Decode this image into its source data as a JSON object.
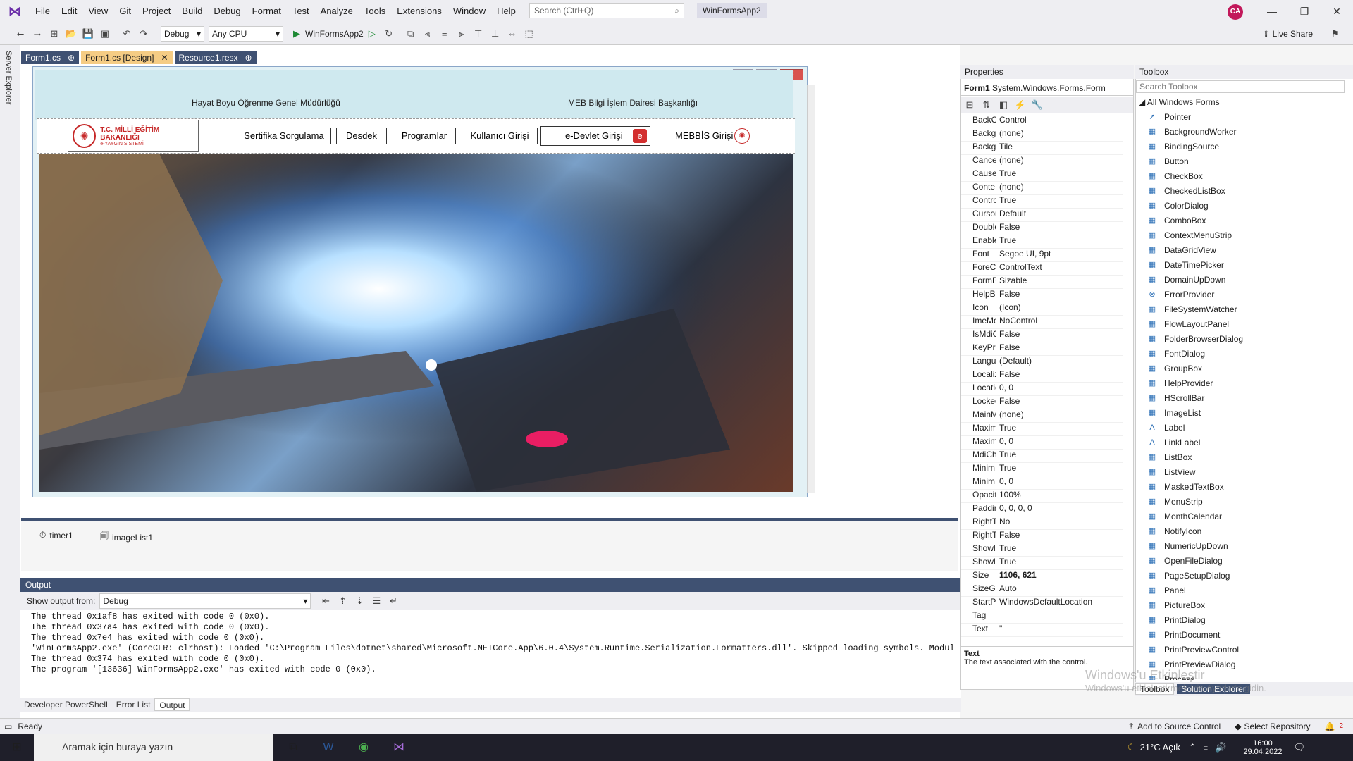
{
  "menubar": {
    "items": [
      "File",
      "Edit",
      "View",
      "Git",
      "Project",
      "Build",
      "Debug",
      "Format",
      "Test",
      "Analyze",
      "Tools",
      "Extensions",
      "Window",
      "Help"
    ],
    "search_placeholder": "Search (Ctrl+Q)",
    "app_name": "WinFormsApp2",
    "avatar": "CA"
  },
  "toolbar": {
    "config": "Debug",
    "platform": "Any CPU",
    "start": "WinFormsApp2",
    "live_share": "Live Share"
  },
  "sidebar": {
    "label": "Server Explorer"
  },
  "tabs": [
    {
      "label": "Form1.cs",
      "active": false
    },
    {
      "label": "Form1.cs [Design]",
      "active": true
    },
    {
      "label": "Resource1.resx",
      "active": false
    }
  ],
  "form": {
    "header_left": "Hayat Boyu Öğrenme Genel Müdürlüğü",
    "header_right": "MEB Bilgi İşlem Dairesi Başkanlığı",
    "logo_title": "T.C. MİLLİ EĞİTİM BAKANLIĞI",
    "logo_sub": "e-YAYGIN SİSTEMİ",
    "buttons": [
      "Sertifika Sorgulama",
      "Desdek",
      "Programlar",
      "Kullanıcı Girişi",
      "e-Devlet Girişi",
      "MEBBİS Girişi"
    ]
  },
  "tray": {
    "items": [
      "timer1",
      "imageList1"
    ]
  },
  "output": {
    "title": "Output",
    "show_from_label": "Show output from:",
    "show_from_value": "Debug",
    "lines": [
      "The thread 0x1af8 has exited with code 0 (0x0).",
      "The thread 0x37a4 has exited with code 0 (0x0).",
      "The thread 0x7e4 has exited with code 0 (0x0).",
      "'WinFormsApp2.exe' (CoreCLR: clrhost): Loaded 'C:\\Program Files\\dotnet\\shared\\Microsoft.NETCore.App\\6.0.4\\System.Runtime.Serialization.Formatters.dll'. Skipped loading symbols. Module is o",
      "The thread 0x374 has exited with code 0 (0x0).",
      "The program '[13636] WinFormsApp2.exe' has exited with code 0 (0x0)."
    ]
  },
  "bottom_tabs": [
    "Developer PowerShell",
    "Error List",
    "Output"
  ],
  "properties": {
    "title": "Properties",
    "object": "Form1",
    "type": "System.Windows.Forms.Form",
    "rows": [
      {
        "n": "BackC",
        "v": "Control"
      },
      {
        "n": "Backg",
        "v": "(none)"
      },
      {
        "n": "Backg",
        "v": "Tile"
      },
      {
        "n": "Cancel",
        "v": "(none)"
      },
      {
        "n": "Causes",
        "v": "True"
      },
      {
        "n": "Conte",
        "v": "(none)"
      },
      {
        "n": "Contro",
        "v": "True"
      },
      {
        "n": "Cursor",
        "v": "Default"
      },
      {
        "n": "Double",
        "v": "False"
      },
      {
        "n": "Enable",
        "v": "True"
      },
      {
        "n": "Font",
        "v": "Segoe UI, 9pt"
      },
      {
        "n": "ForeC",
        "v": "ControlText"
      },
      {
        "n": "FormB",
        "v": "Sizable"
      },
      {
        "n": "HelpB",
        "v": "False"
      },
      {
        "n": "Icon",
        "v": "(Icon)"
      },
      {
        "n": "ImeMo",
        "v": "NoControl"
      },
      {
        "n": "IsMdiC",
        "v": "False"
      },
      {
        "n": "KeyPre",
        "v": "False"
      },
      {
        "n": "Langu",
        "v": "(Default)"
      },
      {
        "n": "Localiz",
        "v": "False"
      },
      {
        "n": "Locatio",
        "v": "0, 0"
      },
      {
        "n": "Locked",
        "v": "False"
      },
      {
        "n": "MainM",
        "v": "(none)"
      },
      {
        "n": "Maxim",
        "v": "True"
      },
      {
        "n": "Maxim",
        "v": "0, 0"
      },
      {
        "n": "MdiCh",
        "v": "True"
      },
      {
        "n": "Minim",
        "v": "True"
      },
      {
        "n": "Minim",
        "v": "0, 0"
      },
      {
        "n": "Opacit",
        "v": "100%"
      },
      {
        "n": "Paddir",
        "v": "0, 0, 0, 0"
      },
      {
        "n": "RightT",
        "v": "No"
      },
      {
        "n": "RightT",
        "v": "False"
      },
      {
        "n": "Showl",
        "v": "True"
      },
      {
        "n": "Showl",
        "v": "True"
      },
      {
        "n": "Size",
        "v": "1106, 621"
      },
      {
        "n": "SizeGr",
        "v": "Auto"
      },
      {
        "n": "StartP",
        "v": "WindowsDefaultLocation"
      },
      {
        "n": "Tag",
        "v": ""
      },
      {
        "n": "Text",
        "v": "\""
      }
    ],
    "desc_title": "Text",
    "desc": "The text associated with the control."
  },
  "toolbox": {
    "title": "Toolbox",
    "search": "Search Toolbox",
    "group": "All Windows Forms",
    "items": [
      "Pointer",
      "BackgroundWorker",
      "BindingSource",
      "Button",
      "CheckBox",
      "CheckedListBox",
      "ColorDialog",
      "ComboBox",
      "ContextMenuStrip",
      "DataGridView",
      "DateTimePicker",
      "DomainUpDown",
      "ErrorProvider",
      "FileSystemWatcher",
      "FlowLayoutPanel",
      "FolderBrowserDialog",
      "FontDialog",
      "GroupBox",
      "HelpProvider",
      "HScrollBar",
      "ImageList",
      "Label",
      "LinkLabel",
      "ListBox",
      "ListView",
      "MaskedTextBox",
      "MenuStrip",
      "MonthCalendar",
      "NotifyIcon",
      "NumericUpDown",
      "OpenFileDialog",
      "PageSetupDialog",
      "Panel",
      "PictureBox",
      "PrintDialog",
      "PrintDocument",
      "PrintPreviewControl",
      "PrintPreviewDialog",
      "Process"
    ],
    "tabs": [
      "Toolbox",
      "Solution Explorer"
    ]
  },
  "statusbar": {
    "ready": "Ready",
    "source_control": "Add to Source Control",
    "repo": "Select Repository",
    "notif": "2"
  },
  "taskbar": {
    "search": "Aramak için buraya yazın",
    "weather": "21°C  Açık",
    "time": "16:00",
    "date": "29.04.2022"
  },
  "watermark": {
    "line1": "Windows'u Etkinleştir",
    "line2": "Windows'u etkinleştirmek için Ayarlar'a gidin."
  }
}
